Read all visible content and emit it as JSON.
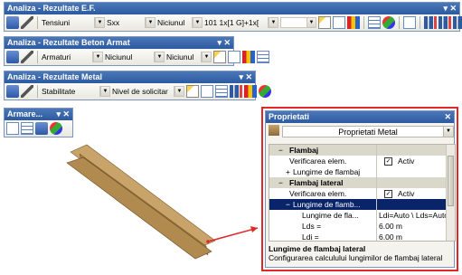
{
  "tb1": {
    "title": "Analiza - Rezultate E.F.",
    "combo1": "Tensiuni",
    "combo2": "Sxx",
    "combo3": "Niciunul",
    "combo4": "101 1x[1 G]+1x[",
    "combo5": ""
  },
  "tb2": {
    "title": "Analiza - Rezultate Beton Armat",
    "combo1": "Armaturi",
    "combo2": "Niciunul",
    "combo3": "Niciunul"
  },
  "tb3": {
    "title": "Analiza - Rezultate Metal",
    "combo1": "Stabilitate",
    "label": "Nivel de solicitar"
  },
  "armare": {
    "title": "Armare..."
  },
  "props": {
    "title": "Proprietati",
    "combo": "Proprietati Metal",
    "rows": [
      {
        "name": "Flambaj",
        "value": ""
      },
      {
        "name": "Verificarea elem.",
        "value": "Activ"
      },
      {
        "name": "Lungime de flambaj",
        "value": ""
      },
      {
        "name": "Flambaj lateral",
        "value": ""
      },
      {
        "name": "Verificarea elem.",
        "value": "Activ"
      },
      {
        "name": "Lungime de flamb...",
        "value": ""
      },
      {
        "name": "Lungime de fla...",
        "value": "Ldi=Auto \\ Lds=Auto"
      },
      {
        "name": "Lds =",
        "value": "6.00 m"
      },
      {
        "name": "Ldi =",
        "value": "6.00 m"
      }
    ],
    "desc_title": "Lungime de flambaj lateral",
    "desc_text": "Configurarea calculului lungimilor de flambaj lateral"
  },
  "colors": {
    "title_bar": "#2d5aa0",
    "selection": "#0a246a",
    "highlight_border": "#e02828",
    "beam": "#b9935a"
  }
}
